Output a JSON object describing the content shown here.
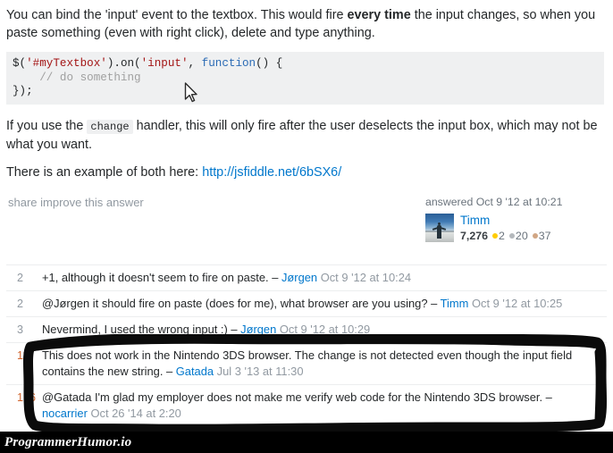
{
  "answer": {
    "paragraph_1_pre": "You can bind the 'input' event to the textbox. This would fire ",
    "paragraph_1_strong": "every time",
    "paragraph_1_post": " the input changes, so when you paste something (even with right click), delete and type anything.",
    "code_line_1_a": "$(",
    "code_line_1_str1": "'#myTextbox'",
    "code_line_1_b": ").on(",
    "code_line_1_str2": "'input'",
    "code_line_1_c": ", ",
    "code_line_1_kw": "function",
    "code_line_1_d": "() {",
    "code_line_2": "    // do something",
    "code_line_3": "});",
    "paragraph_2_pre": "If you use the ",
    "paragraph_2_code": "change",
    "paragraph_2_post": " handler, this will only fire after the user deselects the input box, which may not be what you want.",
    "paragraph_3_pre": "There is an example of both here: ",
    "paragraph_3_link": "http://jsfiddle.net/6bSX6/"
  },
  "post_meta": {
    "share_label": "share",
    "improve_label": "improve this answer",
    "answered_line": "answered Oct 9 '12 at 10:21",
    "user": {
      "name": "Timm",
      "reputation": "7,276",
      "gold": "2",
      "silver": "20",
      "bronze": "37"
    }
  },
  "comments": [
    {
      "score": "2",
      "text": "+1, although it doesn't seem to fire on paste.",
      "dash": " – ",
      "user": "Jørgen",
      "date": "Oct 9 '12 at 10:24",
      "highlighted": "false"
    },
    {
      "score": "2",
      "text": "@Jørgen it should fire on paste (does for me), what browser are you using?",
      "dash": " – ",
      "user": "Timm",
      "date": "Oct 9 '12 at 10:25",
      "highlighted": "false"
    },
    {
      "score": "3",
      "text": "Nevermind, I used the wrong input :)",
      "dash": " – ",
      "user": "Jørgen",
      "date": "Oct 9 '12 at 10:29",
      "highlighted": "false"
    },
    {
      "score": "11",
      "text": "This does not work in the Nintendo 3DS browser. The change is not detected even though the input field contains the new string.",
      "dash": " – ",
      "user": "Gatada",
      "date": "Jul 3 '13 at 11:30",
      "highlighted": "true"
    },
    {
      "score": "136",
      "text": "@Gatada I'm glad my employer does not make me verify web code for the Nintendo 3DS browser.",
      "dash": " – ",
      "user": "nocarrier",
      "date": "Oct 26 '14 at 2:20",
      "highlighted": "true"
    }
  ],
  "annotation": {
    "shape": "hand-drawn-rectangle",
    "color": "#0b0b0b"
  },
  "watermark": {
    "text": "ProgrammerHumor.io"
  },
  "cursor": {
    "icon": "mouse-pointer-arrow"
  },
  "colors": {
    "link": "#0077cc",
    "muted": "#9199a1",
    "code_bg": "#eff0f1",
    "hot_score": "#d1662f",
    "gold": "#ffcc01",
    "silver": "#b4b8bc",
    "bronze": "#d1a684"
  }
}
